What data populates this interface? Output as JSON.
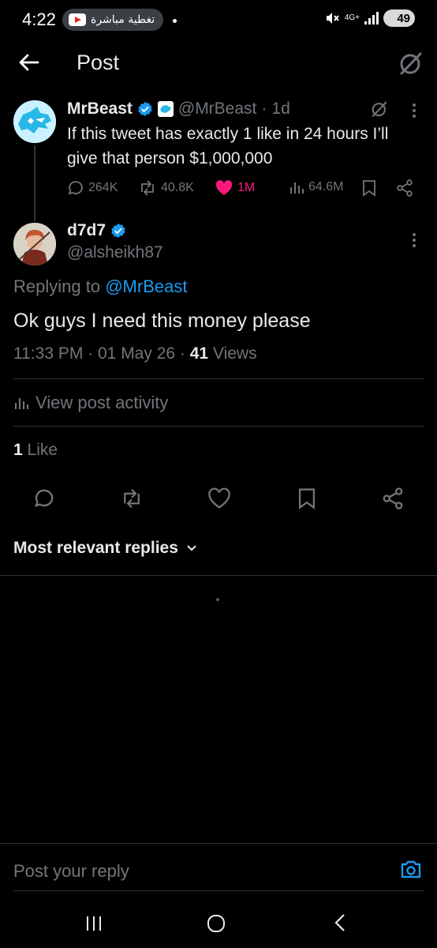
{
  "status_bar": {
    "time": "4:22",
    "live_label": "تغطية مباشرة",
    "network": "4G+",
    "battery": "49"
  },
  "header": {
    "title": "Post"
  },
  "original_tweet": {
    "name": "MrBeast",
    "handle": "@MrBeast",
    "separator": "·",
    "age": "1d",
    "text": "If this tweet has exactly 1 like in 24 hours I’ll give that person $1,000,000",
    "replies": "264K",
    "reposts": "40.8K",
    "likes": "1M",
    "views": "64.6M"
  },
  "reply_tweet": {
    "name": "d7d7",
    "handle": "@alsheikh87",
    "replying_prefix": "Replying to",
    "replying_to": "@MrBeast",
    "text": "Ok guys I need this money please",
    "time": "11:33 PM",
    "date": "01 May 26",
    "views_count": "41",
    "views_label": "Views",
    "activity_label": "View post activity",
    "like_count": "1",
    "like_label": "Like"
  },
  "replies_section": {
    "sort_label": "Most relevant replies"
  },
  "reply_bar": {
    "placeholder": "Post your reply"
  },
  "colors": {
    "background": "#000000",
    "accent": "#1d9bf0",
    "like_pink": "#f91880",
    "secondary_text": "#71767b"
  }
}
